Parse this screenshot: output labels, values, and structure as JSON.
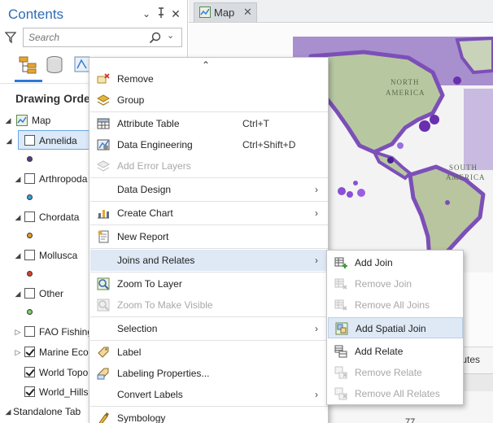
{
  "contents_pane": {
    "title": "Contents",
    "search_placeholder": "Search",
    "drawing_order_label": "Drawing Order",
    "map_label": "Map",
    "layers": [
      {
        "label": "Annelida",
        "checked": false,
        "swatch": "#5b3b8c"
      },
      {
        "label": "Arthropoda",
        "checked": false,
        "swatch": "#3aa0d8"
      },
      {
        "label": "Chordata",
        "checked": false,
        "swatch": "#e29a2a"
      },
      {
        "label": "Mollusca",
        "checked": false,
        "swatch": "#d8432a"
      },
      {
        "label": "Other",
        "checked": false,
        "swatch": "#7fcf6a"
      },
      {
        "label": "FAO Fishing",
        "checked": false
      },
      {
        "label": "Marine Eco",
        "checked": true
      },
      {
        "label": "World Topo",
        "checked": true
      },
      {
        "label": "World_Hills",
        "checked": true
      }
    ],
    "standalone_label": "Standalone Tab"
  },
  "map_view": {
    "tab_label": "Map",
    "map_labels": [
      "NORTH",
      "AMERICA",
      "SOUTH",
      "AMERICA"
    ],
    "attr_header_fragment": "ributes",
    "attr_value_fragment": "77"
  },
  "context_menu": {
    "items": [
      {
        "label": "Remove",
        "icon": "remove-icon"
      },
      {
        "label": "Group",
        "icon": "group-icon"
      },
      {
        "label": "Attribute Table",
        "shortcut": "Ctrl+T",
        "icon": "table-icon"
      },
      {
        "label": "Data Engineering",
        "shortcut": "Ctrl+Shift+D",
        "icon": "data-engineering-icon"
      },
      {
        "label": "Add Error Layers",
        "disabled": true,
        "icon": "error-layers-icon"
      },
      {
        "label": "Data Design"
      },
      {
        "label": "Create Chart",
        "icon": "chart-icon"
      },
      {
        "label": "New Report",
        "icon": "report-icon"
      },
      {
        "label": "Joins and Relates"
      },
      {
        "label": "Zoom To Layer",
        "icon": "zoom-layer-icon"
      },
      {
        "label": "Zoom To Make Visible",
        "disabled": true,
        "icon": "zoom-visible-icon"
      },
      {
        "label": "Selection"
      },
      {
        "label": "Label",
        "icon": "label-icon"
      },
      {
        "label": "Labeling Properties...",
        "icon": "labeling-properties-icon"
      },
      {
        "label": "Convert Labels"
      },
      {
        "label": "Symbology",
        "icon": "symbology-icon"
      }
    ]
  },
  "joins_submenu": {
    "items": [
      {
        "label": "Add Join"
      },
      {
        "label": "Remove Join",
        "disabled": true
      },
      {
        "label": "Remove All Joins",
        "disabled": true
      },
      {
        "label": "Add Spatial Join"
      },
      {
        "label": "Add Relate"
      },
      {
        "label": "Remove Relate",
        "disabled": true
      },
      {
        "label": "Remove All Relates",
        "disabled": true
      }
    ]
  }
}
